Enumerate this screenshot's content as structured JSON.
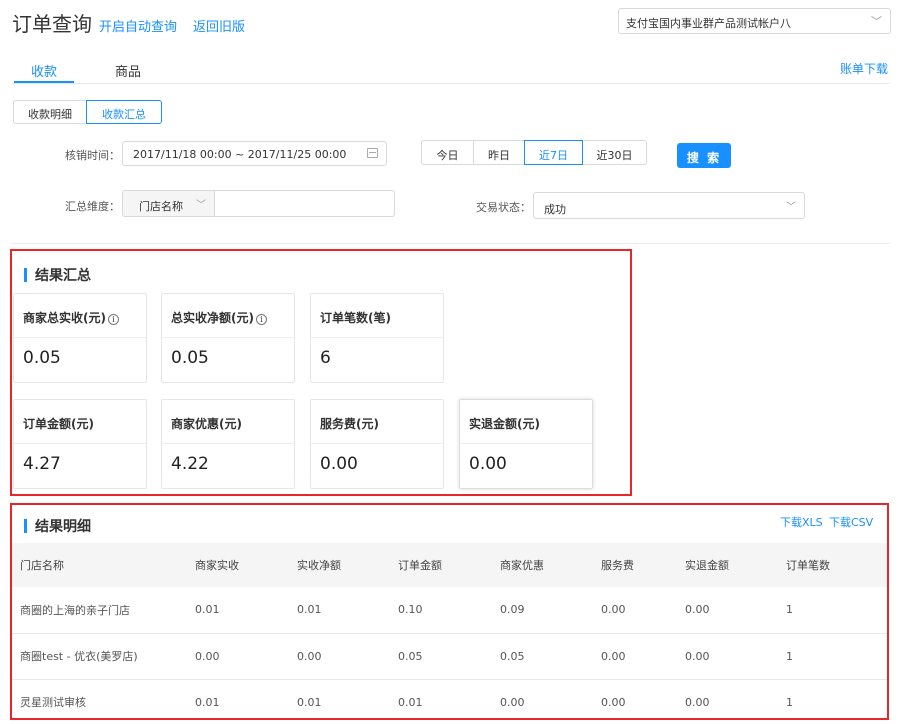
{
  "header": {
    "title": "订单查询",
    "auto_query": "开启自动查询",
    "back_old": "返回旧版",
    "account": "支付宝国内事业群产品测试帐户八",
    "bill_download": "账单下载"
  },
  "tabs": [
    {
      "label": "收款"
    },
    {
      "label": "商品"
    }
  ],
  "subtabs": [
    {
      "label": "收款明细"
    },
    {
      "label": "收款汇总"
    }
  ],
  "filters": {
    "time_label": "核销时间：",
    "time_value": "2017/11/18 00:00  ~  2017/11/25 00:00",
    "quick": [
      "今日",
      "昨日",
      "近7日",
      "近30日"
    ],
    "search_label": "搜 索",
    "dim_label": "汇总维度：",
    "dim_value": "门店名称",
    "status_label": "交易状态：",
    "status_value": "成功"
  },
  "summary": {
    "title": "结果汇总",
    "cards": [
      {
        "label": "商家总实收(元)",
        "value": "0.05",
        "info": true
      },
      {
        "label": "总实收净额(元)",
        "value": "0.05",
        "info": true
      },
      {
        "label": "订单笔数(笔)",
        "value": "6"
      },
      {
        "label": "订单金额(元)",
        "value": "4.27"
      },
      {
        "label": "商家优惠(元)",
        "value": "4.22"
      },
      {
        "label": "服务费(元)",
        "value": "0.00"
      },
      {
        "label": "实退金额(元)",
        "value": "0.00"
      }
    ]
  },
  "detail": {
    "title": "结果明细",
    "download_xls": "下载XLS",
    "download_csv": "下载CSV",
    "columns": [
      "门店名称",
      "商家实收",
      "实收净额",
      "订单金额",
      "商家优惠",
      "服务费",
      "实退金额",
      "订单笔数"
    ],
    "rows": [
      [
        "商圈的上海的亲子门店",
        "0.01",
        "0.01",
        "0.10",
        "0.09",
        "0.00",
        "0.00",
        "1"
      ],
      [
        "商圈test - 优衣(美罗店)",
        "0.00",
        "0.00",
        "0.05",
        "0.05",
        "0.00",
        "0.00",
        "1"
      ],
      [
        "灵星测试审核",
        "0.01",
        "0.01",
        "0.01",
        "0.00",
        "0.00",
        "0.00",
        "1"
      ]
    ]
  },
  "colors": {
    "accent": "#1890ff",
    "highlight_border": "#e8262a"
  }
}
